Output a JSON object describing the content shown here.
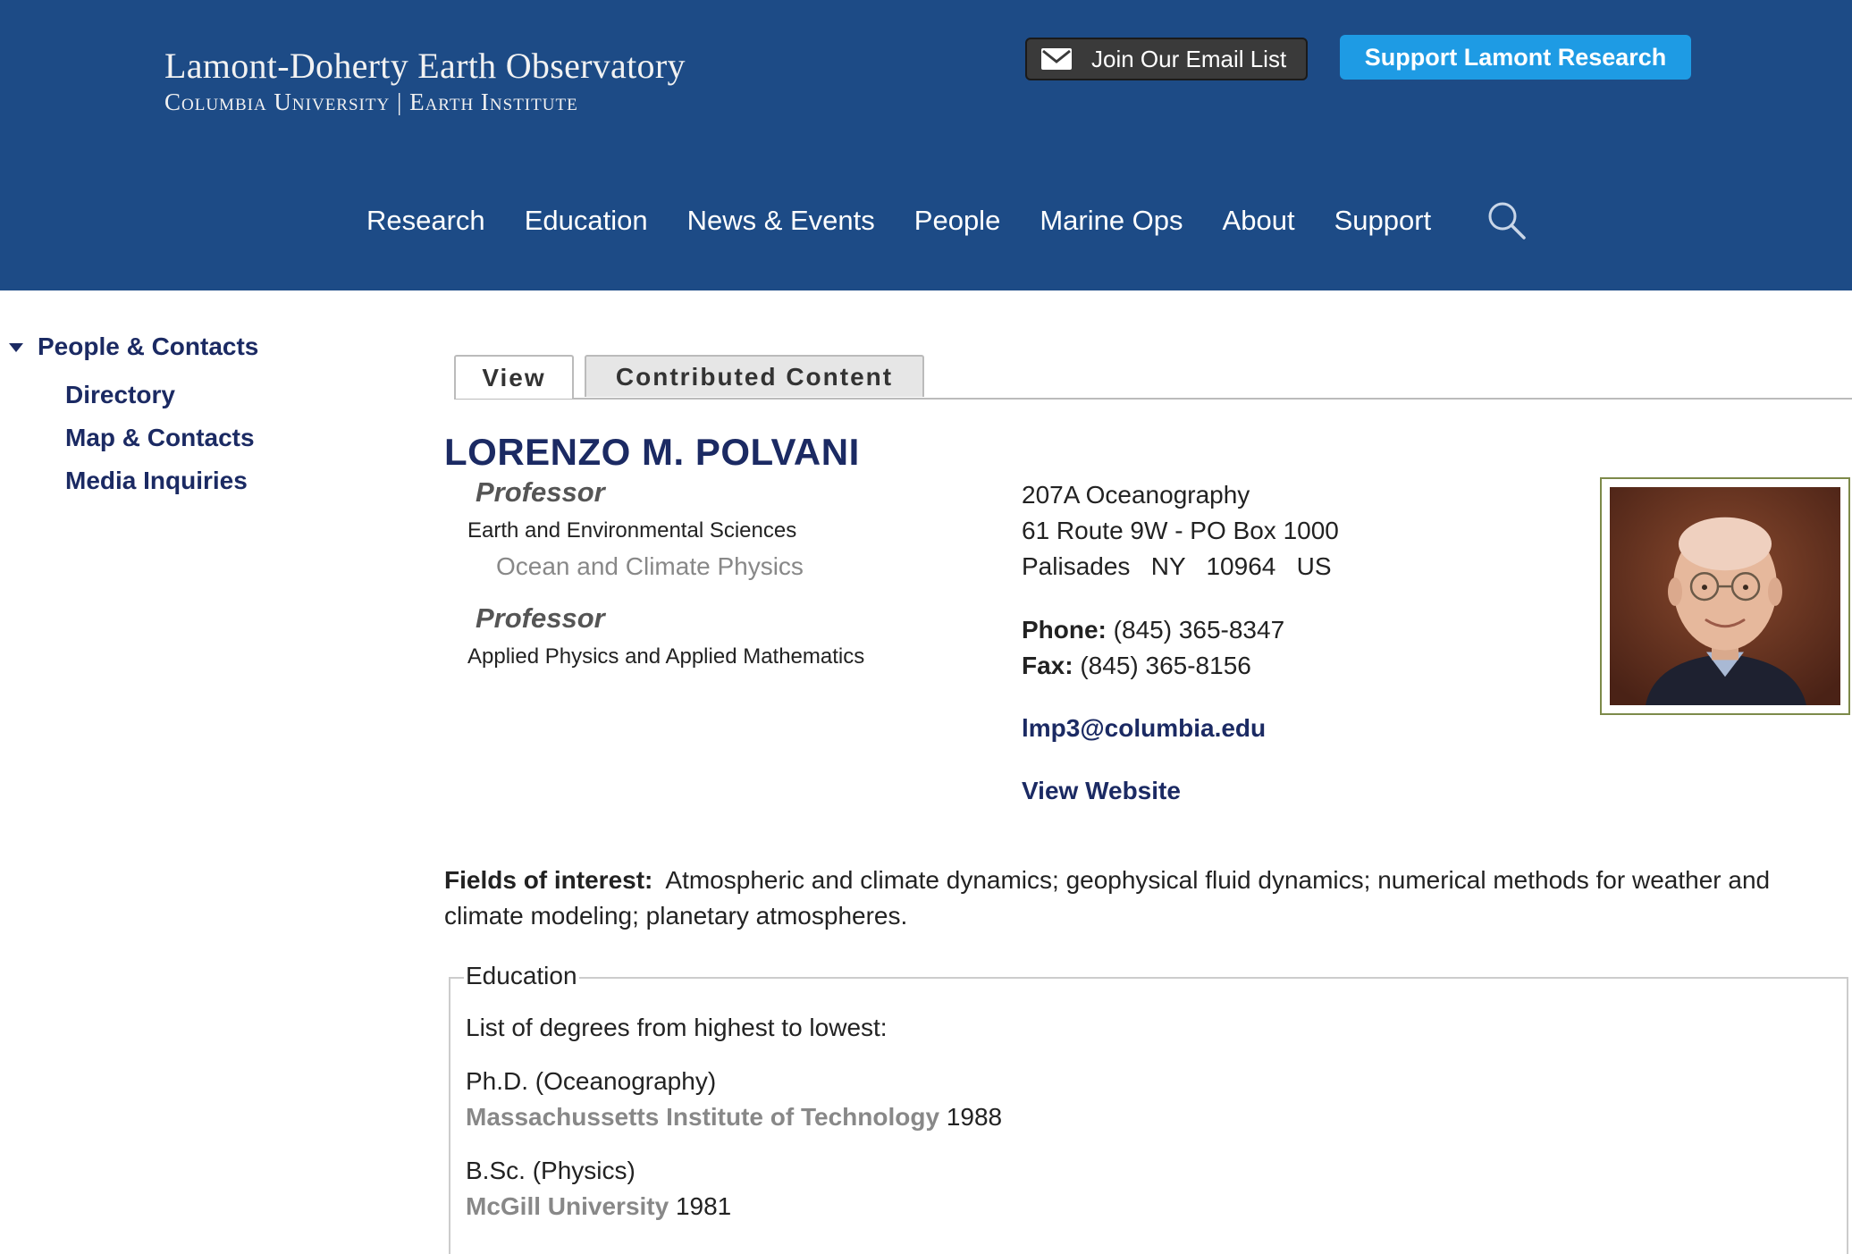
{
  "header": {
    "logo_line1": "Lamont-Doherty Earth Observatory",
    "logo_line2": "Columbia University | Earth Institute",
    "email_button": "Join Our Email List",
    "email_icon": "envelope-icon",
    "support_button": "Support Lamont Research",
    "nav": [
      "Research",
      "Education",
      "News & Events",
      "People",
      "Marine Ops",
      "About",
      "Support"
    ],
    "search_icon": "magnifier-icon",
    "colors": {
      "header_bg": "#1d4b86",
      "support_bg": "#1e9be4"
    }
  },
  "sidebar": {
    "heading": "People & Contacts",
    "items": [
      "Directory",
      "Map & Contacts",
      "Media Inquiries"
    ]
  },
  "tabs": [
    "View",
    "Contributed Content"
  ],
  "profile": {
    "name": "LORENZO M. POLVANI",
    "roles": [
      {
        "title": "Professor",
        "dept": "Earth and Environmental Sciences",
        "subdept": "Ocean and Climate Physics"
      },
      {
        "title": "Professor",
        "dept": "Applied Physics and Applied Mathematics"
      }
    ],
    "address": [
      "207A Oceanography",
      "61 Route 9W - PO Box 1000",
      "Palisades   NY   10964   US"
    ],
    "phone_label": "Phone:",
    "phone": "(845) 365-8347",
    "fax_label": "Fax:",
    "fax": "(845) 365-8156",
    "email": "lmp3@columbia.edu",
    "website": "View Website"
  },
  "fields": {
    "label": "Fields of interest:",
    "text": "Atmospheric and climate dynamics; geophysical fluid dynamics; numerical methods for weather and climate modeling; planetary atmospheres."
  },
  "education": {
    "legend": "Education",
    "intro": "List of degrees from highest to lowest:",
    "degrees": [
      {
        "degree": "Ph.D. (Oceanography)",
        "institution": "Massachussetts Institute of Technology",
        "year": "1988"
      },
      {
        "degree": "B.Sc. (Physics)",
        "institution": "McGill University",
        "year": "1981"
      }
    ]
  }
}
